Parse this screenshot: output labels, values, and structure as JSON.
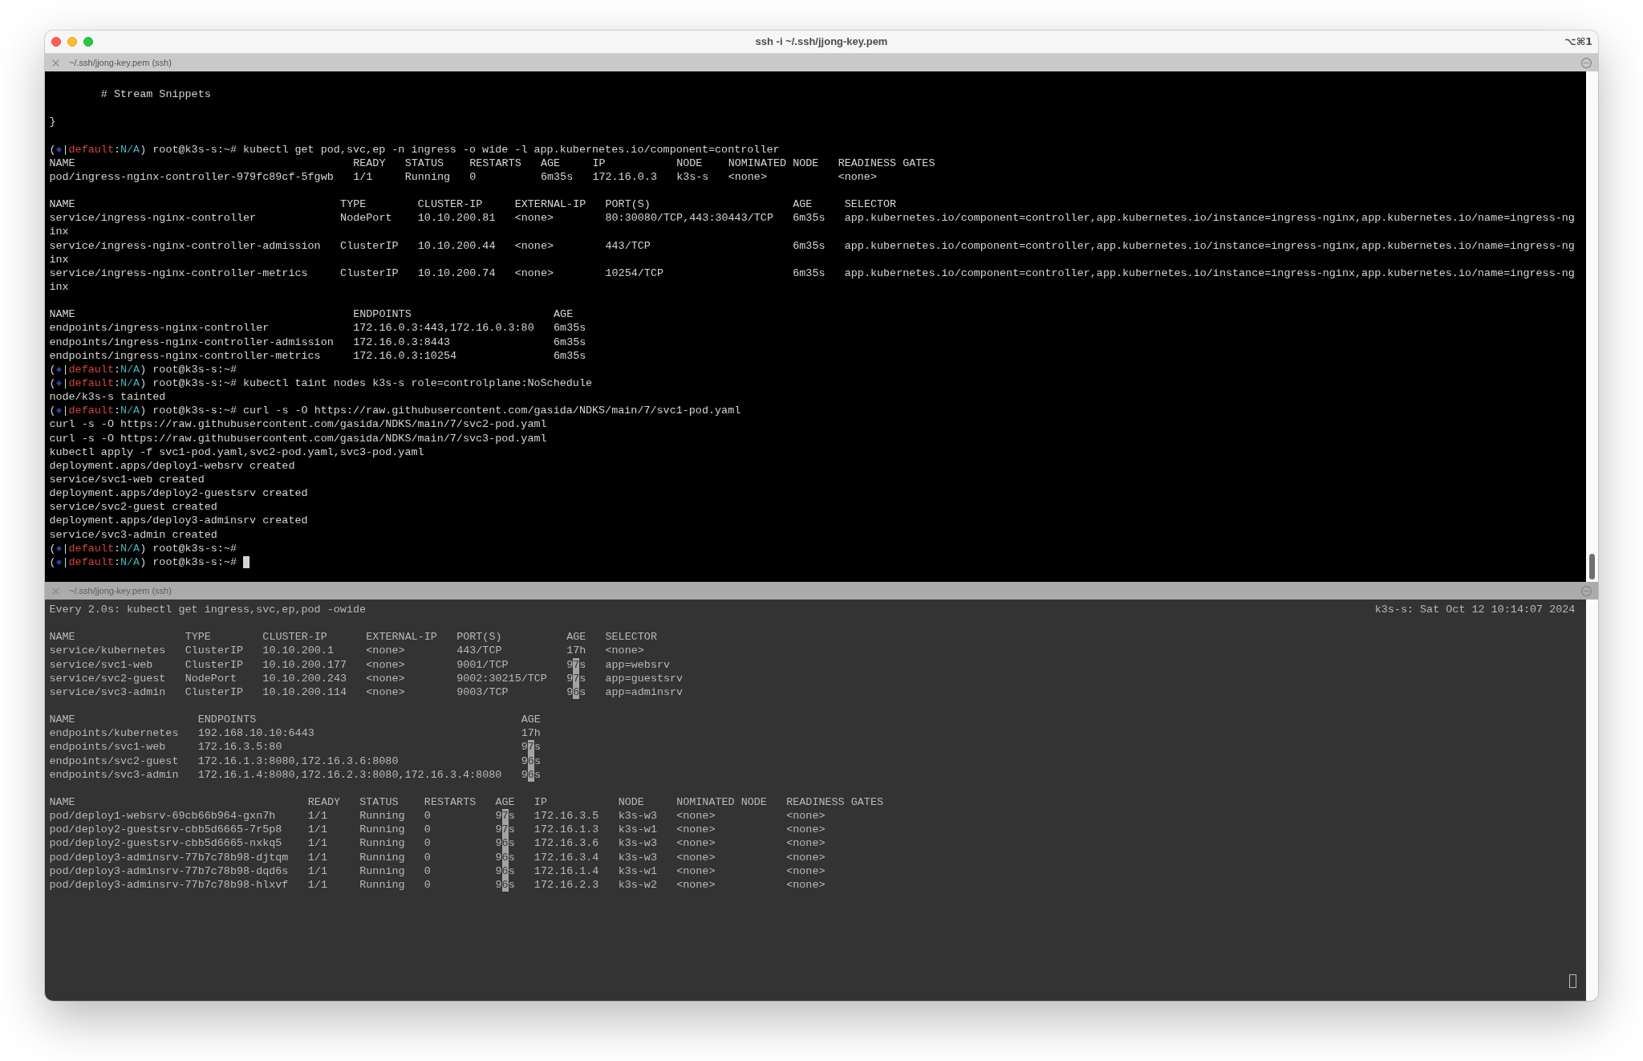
{
  "window": {
    "title": "ssh -i ~/.ssh/jjong-key.pem",
    "shortcut": "⌥⌘1"
  },
  "panes": [
    {
      "title": "~/.ssh/jjong-key.pem (ssh)",
      "focused": true,
      "scrollback": true,
      "groups": [
        [
          {
            "kind": "text",
            "text": "        # Stream Snippets"
          }
        ],
        [
          {
            "kind": "text",
            "text": "}"
          }
        ],
        [
          {
            "kind": "prompt",
            "open": "(",
            "segments": [
              {
                "text": "|"
              },
              {
                "text": "default",
                "color": "#d0453b"
              },
              {
                "text": ":"
              },
              {
                "text": "N/A",
                "color": "#3ab3bf"
              },
              {
                "text": ") root@k3s-s:~# kubectl get pod,svc,ep -n ingress -o wide -l app.kubernetes.io/component=controller"
              }
            ],
            "cursor": false
          },
          {
            "kind": "table",
            "columns": [
              "NAME",
              "READY",
              "STATUS",
              "RESTARTS",
              "AGE",
              "IP",
              "NODE",
              "NOMINATED NODE",
              "READINESS GATES"
            ],
            "rows": [
              {
                "cells": [
                  "pod/ingress-nginx-controller-979fc89cf-5fgwb",
                  "1/1",
                  "Running",
                  "0",
                  "6m35s",
                  "172.16.0.3",
                  "k3s-s",
                  "<none>",
                  "<none>"
                ]
              }
            ]
          }
        ],
        [
          {
            "kind": "table",
            "columns": [
              "NAME",
              "TYPE",
              "CLUSTER-IP",
              "EXTERNAL-IP",
              "PORT(S)",
              "AGE",
              "SELECTOR"
            ],
            "rows": [
              {
                "cells": [
                  "service/ingress-nginx-controller",
                  "NodePort",
                  "10.10.200.81",
                  "<none>",
                  "80:30080/TCP,443:30443/TCP",
                  "6m35s",
                  "app.kubernetes.io/component=controller,app.kubernetes.io/instance=ingress-nginx,app.kubernetes.io/name=ingress-ng"
                ],
                "continuation": "inx"
              },
              {
                "cells": [
                  "service/ingress-nginx-controller-admission",
                  "ClusterIP",
                  "10.10.200.44",
                  "<none>",
                  "443/TCP",
                  "6m35s",
                  "app.kubernetes.io/component=controller,app.kubernetes.io/instance=ingress-nginx,app.kubernetes.io/name=ingress-ng"
                ],
                "continuation": "inx"
              },
              {
                "cells": [
                  "service/ingress-nginx-controller-metrics",
                  "ClusterIP",
                  "10.10.200.74",
                  "<none>",
                  "10254/TCP",
                  "6m35s",
                  "app.kubernetes.io/component=controller,app.kubernetes.io/instance=ingress-nginx,app.kubernetes.io/name=ingress-ng"
                ],
                "continuation": "inx"
              }
            ]
          }
        ],
        [
          {
            "kind": "table",
            "columns": [
              "NAME",
              "ENDPOINTS",
              "AGE"
            ],
            "rows": [
              {
                "cells": [
                  "endpoints/ingress-nginx-controller",
                  "172.16.0.3:443,172.16.0.3:80",
                  "6m35s"
                ]
              },
              {
                "cells": [
                  "endpoints/ingress-nginx-controller-admission",
                  "172.16.0.3:8443",
                  "6m35s"
                ]
              },
              {
                "cells": [
                  "endpoints/ingress-nginx-controller-metrics",
                  "172.16.0.3:10254",
                  "6m35s"
                ]
              }
            ]
          },
          {
            "kind": "prompt",
            "open": "(",
            "segments": [
              {
                "text": "|"
              },
              {
                "text": "default",
                "color": "#d0453b"
              },
              {
                "text": ":"
              },
              {
                "text": "N/A",
                "color": "#3ab3bf"
              },
              {
                "text": ") root@k3s-s:~#"
              }
            ],
            "cursor": false
          },
          {
            "kind": "prompt",
            "open": "(",
            "segments": [
              {
                "text": "|"
              },
              {
                "text": "default",
                "color": "#d0453b"
              },
              {
                "text": ":"
              },
              {
                "text": "N/A",
                "color": "#3ab3bf"
              },
              {
                "text": ") root@k3s-s:~# kubectl taint nodes k3s-s role=controlplane:NoSchedule"
              }
            ],
            "cursor": false
          },
          {
            "kind": "text",
            "text": "node/k3s-s tainted"
          },
          {
            "kind": "prompt",
            "open": "(",
            "segments": [
              {
                "text": "|"
              },
              {
                "text": "default",
                "color": "#d0453b"
              },
              {
                "text": ":"
              },
              {
                "text": "N/A",
                "color": "#3ab3bf"
              },
              {
                "text": ") root@k3s-s:~# curl -s -O https://raw.githubusercontent.com/gasida/NDKS/main/7/svc1-pod.yaml"
              }
            ],
            "cursor": false
          },
          {
            "kind": "text",
            "text": "curl -s -O https://raw.githubusercontent.com/gasida/NDKS/main/7/svc2-pod.yaml"
          },
          {
            "kind": "text",
            "text": "curl -s -O https://raw.githubusercontent.com/gasida/NDKS/main/7/svc3-pod.yaml"
          },
          {
            "kind": "text",
            "text": "kubectl apply -f svc1-pod.yaml,svc2-pod.yaml,svc3-pod.yaml"
          },
          {
            "kind": "text",
            "text": "deployment.apps/deploy1-websrv created"
          },
          {
            "kind": "text",
            "text": "service/svc1-web created"
          },
          {
            "kind": "text",
            "text": "deployment.apps/deploy2-guestsrv created"
          },
          {
            "kind": "text",
            "text": "service/svc2-guest created"
          },
          {
            "kind": "text",
            "text": "deployment.apps/deploy3-adminsrv created"
          },
          {
            "kind": "text",
            "text": "service/svc3-admin created"
          },
          {
            "kind": "prompt",
            "open": "(",
            "segments": [
              {
                "text": "|"
              },
              {
                "text": "default",
                "color": "#d0453b"
              },
              {
                "text": ":"
              },
              {
                "text": "N/A",
                "color": "#3ab3bf"
              },
              {
                "text": ") root@k3s-s:~#"
              }
            ],
            "cursor": false
          },
          {
            "kind": "prompt",
            "open": "(",
            "segments": [
              {
                "text": "|"
              },
              {
                "text": "default",
                "color": "#d0453b"
              },
              {
                "text": ":"
              },
              {
                "text": "N/A",
                "color": "#3ab3bf"
              },
              {
                "text": ") root@k3s-s:~#"
              }
            ],
            "cursor": true
          }
        ]
      ]
    },
    {
      "title": "~/.ssh/jjong-key.pem (ssh)",
      "focused": false,
      "scrollback": false,
      "cursor": true,
      "groups": [
        [
          {
            "kind": "watch",
            "command": "Every 2.0s: kubectl get ingress,svc,ep,pod -owide",
            "clock": "k3s-s: Sat Oct 12 10:14:07 2024"
          }
        ],
        [
          {
            "kind": "table",
            "columns": [
              "NAME",
              "TYPE",
              "CLUSTER-IP",
              "EXTERNAL-IP",
              "PORT(S)",
              "AGE",
              "SELECTOR"
            ],
            "rows": [
              {
                "cells": [
                  "service/kubernetes",
                  "ClusterIP",
                  "10.10.200.1",
                  "<none>",
                  "443/TCP",
                  "17h",
                  "<none>"
                ]
              },
              {
                "cells": [
                  "service/svc1-web",
                  "ClusterIP",
                  "10.10.200.177",
                  "<none>",
                  "9001/TCP",
                  {
                    "segments": [
                      {
                        "text": "9",
                        "changed": false
                      },
                      {
                        "text": "7",
                        "changed": true
                      },
                      {
                        "text": "s",
                        "changed": false
                      }
                    ]
                  },
                  "app=websrv"
                ]
              },
              {
                "cells": [
                  "service/svc2-guest",
                  "NodePort",
                  "10.10.200.243",
                  "<none>",
                  "9002:30215/TCP",
                  {
                    "segments": [
                      {
                        "text": "9",
                        "changed": false
                      },
                      {
                        "text": "7",
                        "changed": true
                      },
                      {
                        "text": "s",
                        "changed": false
                      }
                    ]
                  },
                  "app=guestsrv"
                ]
              },
              {
                "cells": [
                  "service/svc3-admin",
                  "ClusterIP",
                  "10.10.200.114",
                  "<none>",
                  "9003/TCP",
                  {
                    "segments": [
                      {
                        "text": "9",
                        "changed": false
                      },
                      {
                        "text": "6",
                        "changed": true
                      },
                      {
                        "text": "s",
                        "changed": false
                      }
                    ]
                  },
                  "app=adminsrv"
                ]
              }
            ]
          }
        ],
        [
          {
            "kind": "table",
            "columns": [
              "NAME",
              "ENDPOINTS",
              "AGE"
            ],
            "rows": [
              {
                "cells": [
                  "endpoints/kubernetes",
                  "192.168.10.10:6443",
                  "17h"
                ]
              },
              {
                "cells": [
                  "endpoints/svc1-web",
                  "172.16.3.5:80",
                  {
                    "segments": [
                      {
                        "text": "9",
                        "changed": false
                      },
                      {
                        "text": "7",
                        "changed": true
                      },
                      {
                        "text": "s",
                        "changed": false
                      }
                    ]
                  }
                ]
              },
              {
                "cells": [
                  "endpoints/svc2-guest",
                  "172.16.1.3:8080,172.16.3.6:8080",
                  {
                    "segments": [
                      {
                        "text": "9",
                        "changed": false
                      },
                      {
                        "text": "6",
                        "changed": true
                      },
                      {
                        "text": "s",
                        "changed": false
                      }
                    ]
                  }
                ]
              },
              {
                "cells": [
                  "endpoints/svc3-admin",
                  "172.16.1.4:8080,172.16.2.3:8080,172.16.3.4:8080",
                  {
                    "segments": [
                      {
                        "text": "9",
                        "changed": false
                      },
                      {
                        "text": "6",
                        "changed": true
                      },
                      {
                        "text": "s",
                        "changed": false
                      }
                    ]
                  }
                ]
              }
            ]
          }
        ],
        [
          {
            "kind": "table",
            "columns": [
              "NAME",
              "READY",
              "STATUS",
              "RESTARTS",
              "AGE",
              "IP",
              "NODE",
              "NOMINATED NODE",
              "READINESS GATES"
            ],
            "rows": [
              {
                "cells": [
                  "pod/deploy1-websrv-69cb66b964-gxn7h",
                  "1/1",
                  "Running",
                  "0",
                  {
                    "segments": [
                      {
                        "text": "9",
                        "changed": false
                      },
                      {
                        "text": "7",
                        "changed": true
                      },
                      {
                        "text": "s",
                        "changed": false
                      }
                    ]
                  },
                  "172.16.3.5",
                  "k3s-w3",
                  "<none>",
                  "<none>"
                ]
              },
              {
                "cells": [
                  "pod/deploy2-guestsrv-cbb5d6665-7r5p8",
                  "1/1",
                  "Running",
                  "0",
                  {
                    "segments": [
                      {
                        "text": "9",
                        "changed": false
                      },
                      {
                        "text": "7",
                        "changed": true
                      },
                      {
                        "text": "s",
                        "changed": false
                      }
                    ]
                  },
                  "172.16.1.3",
                  "k3s-w1",
                  "<none>",
                  "<none>"
                ]
              },
              {
                "cells": [
                  "pod/deploy2-guestsrv-cbb5d6665-nxkq5",
                  "1/1",
                  "Running",
                  "0",
                  {
                    "segments": [
                      {
                        "text": "9",
                        "changed": false
                      },
                      {
                        "text": "6",
                        "changed": true
                      },
                      {
                        "text": "s",
                        "changed": false
                      }
                    ]
                  },
                  "172.16.3.6",
                  "k3s-w3",
                  "<none>",
                  "<none>"
                ]
              },
              {
                "cells": [
                  "pod/deploy3-adminsrv-77b7c78b98-djtqm",
                  "1/1",
                  "Running",
                  "0",
                  {
                    "segments": [
                      {
                        "text": "9",
                        "changed": false
                      },
                      {
                        "text": "6",
                        "changed": true
                      },
                      {
                        "text": "s",
                        "changed": false
                      }
                    ]
                  },
                  "172.16.3.4",
                  "k3s-w3",
                  "<none>",
                  "<none>"
                ]
              },
              {
                "cells": [
                  "pod/deploy3-adminsrv-77b7c78b98-dqd6s",
                  "1/1",
                  "Running",
                  "0",
                  {
                    "segments": [
                      {
                        "text": "9",
                        "changed": false
                      },
                      {
                        "text": "6",
                        "changed": true
                      },
                      {
                        "text": "s",
                        "changed": false
                      }
                    ]
                  },
                  "172.16.1.4",
                  "k3s-w1",
                  "<none>",
                  "<none>"
                ]
              },
              {
                "cells": [
                  "pod/deploy3-adminsrv-77b7c78b98-hlxvf",
                  "1/1",
                  "Running",
                  "0",
                  {
                    "segments": [
                      {
                        "text": "9",
                        "changed": false
                      },
                      {
                        "text": "6",
                        "changed": true
                      },
                      {
                        "text": "s",
                        "changed": false
                      }
                    ]
                  },
                  "172.16.2.3",
                  "k3s-w2",
                  "<none>",
                  "<none>"
                ]
              }
            ]
          }
        ]
      ]
    }
  ]
}
